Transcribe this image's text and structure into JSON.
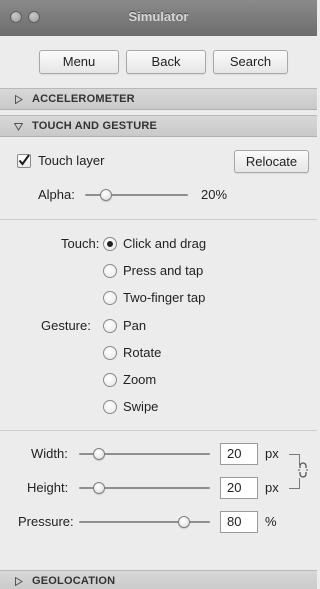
{
  "window": {
    "title": "Simulator"
  },
  "toolbar": {
    "menu_label": "Menu",
    "back_label": "Back",
    "search_label": "Search"
  },
  "sections": {
    "accelerometer": {
      "label": "ACCELEROMETER",
      "expanded": false
    },
    "touch": {
      "label": "TOUCH AND GESTURE",
      "expanded": true
    },
    "geolocation": {
      "label": "GEOLOCATION",
      "expanded": false
    }
  },
  "touch_layer": {
    "checkbox_label": "Touch layer",
    "checked": true,
    "relocate_label": "Relocate",
    "alpha_label": "Alpha:",
    "alpha_value": "20%",
    "alpha_fraction": 0.2
  },
  "touch_options": {
    "touch_label": "Touch:",
    "touch_items": [
      "Click and drag",
      "Press and tap",
      "Two-finger tap"
    ],
    "touch_selected": 0,
    "gesture_label": "Gesture:",
    "gesture_items": [
      "Pan",
      "Rotate",
      "Zoom",
      "Swipe"
    ]
  },
  "size": {
    "width_label": "Width:",
    "width_value": "20",
    "width_fraction": 0.15,
    "height_label": "Height:",
    "height_value": "20",
    "height_fraction": 0.15,
    "unit_px": "px",
    "pressure_label": "Pressure:",
    "pressure_value": "80",
    "pressure_fraction": 0.8,
    "unit_percent": "%"
  },
  "colors": {
    "titlebar": "#7a7a7a",
    "section_header": "#d0d0d0",
    "panel_bg": "#ececec"
  }
}
